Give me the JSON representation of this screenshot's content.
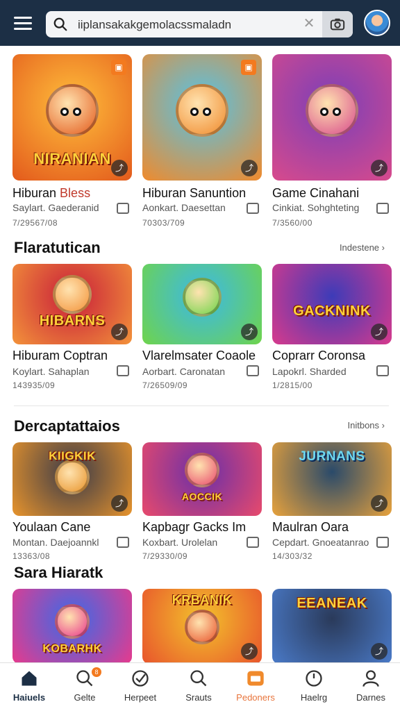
{
  "header": {
    "search_text": "iiplansakakgemolacssmaladn"
  },
  "row1": [
    {
      "thumb_title": "NIRANIAN",
      "title_a": "Hiburan ",
      "title_b": "Bless",
      "sub": "Saylart. Gaederanid",
      "meta": "7/29567/08",
      "colors": [
        "#ffbe3b",
        "#e35a1c"
      ]
    },
    {
      "thumb_title": "",
      "title_a": "Hiburan ",
      "title_b": "Sanuntion",
      "sub": "Aonkart. Daesettan",
      "meta": "70303/709",
      "colors": [
        "#53c3e8",
        "#f08a2c"
      ]
    },
    {
      "thumb_title": "",
      "title_a": "Game ",
      "title_b": "Cinahani",
      "sub": "Cinkiat. Sohghteting",
      "meta": "7/3560/00",
      "colors": [
        "#7a3fb8",
        "#d84a8c"
      ]
    }
  ],
  "section1": {
    "title": "Flaratutican",
    "link": "Indestene"
  },
  "row2": [
    {
      "thumb_title": "HIBARNS",
      "title": "Hiburam Coptran",
      "sub": "Koylart. Sahaplan",
      "meta": "143935/09",
      "colors": [
        "#c81e3a",
        "#f3933a"
      ]
    },
    {
      "thumb_title": "",
      "title": "Vlarelmsater Coaole",
      "sub": "Aorbart. Caronatan",
      "meta": "7/26509/09",
      "colors": [
        "#3bb8e8",
        "#6fd44a"
      ]
    },
    {
      "thumb_title": "GACKNINK",
      "title": "Coprarr Coronsa",
      "sub": "Lapokrl. Sharded",
      "meta": "1/2815/00",
      "colors": [
        "#3d3bb8",
        "#d83a8c"
      ]
    }
  ],
  "section2": {
    "title": "Dercaptattaios",
    "link": "Initbons"
  },
  "row3": [
    {
      "thumb_title": "KIIGKIK",
      "title": "Youlaan Cane",
      "sub": "Montan. Daejoannkl",
      "meta": "13363/08",
      "colors": [
        "#3a3a48",
        "#e8942c"
      ]
    },
    {
      "thumb_title": "AOCCIK",
      "title": "Kapbagr Gacks Im",
      "sub": "Koxbart. Urolelan",
      "meta": "7/29330/09",
      "colors": [
        "#6a2fa8",
        "#e84a6c"
      ]
    },
    {
      "thumb_title": "JURNANS",
      "title": "Maulran Oara",
      "sub": "Cepdart. Gnoeatanrao",
      "meta": "14/303/32",
      "colors": [
        "#2a4a6a",
        "#e8a23c"
      ]
    }
  ],
  "section3": {
    "title": "Sara Hiaratk"
  },
  "row4": [
    {
      "thumb_title": "KOBARHK",
      "colors": [
        "#3a6ae8",
        "#e83a8c"
      ]
    },
    {
      "thumb_title": "KRBANIK",
      "colors": [
        "#f3c22c",
        "#e8542c"
      ]
    },
    {
      "thumb_title": "EEANEAK",
      "colors": [
        "#2a3a5a",
        "#4a7ac8"
      ]
    }
  ],
  "nav": [
    {
      "label": "Haiuels",
      "icon": "home-icon",
      "active": true
    },
    {
      "label": "Gelte",
      "icon": "search-icon",
      "badge": "8"
    },
    {
      "label": "Herpeet",
      "icon": "check-badge-icon"
    },
    {
      "label": "Srauts",
      "icon": "search-icon"
    },
    {
      "label": "Pedoners",
      "icon": "tv-icon",
      "highlight": true
    },
    {
      "label": "Haelrg",
      "icon": "clock-icon"
    },
    {
      "label": "Darnes",
      "icon": "profile-icon"
    }
  ]
}
